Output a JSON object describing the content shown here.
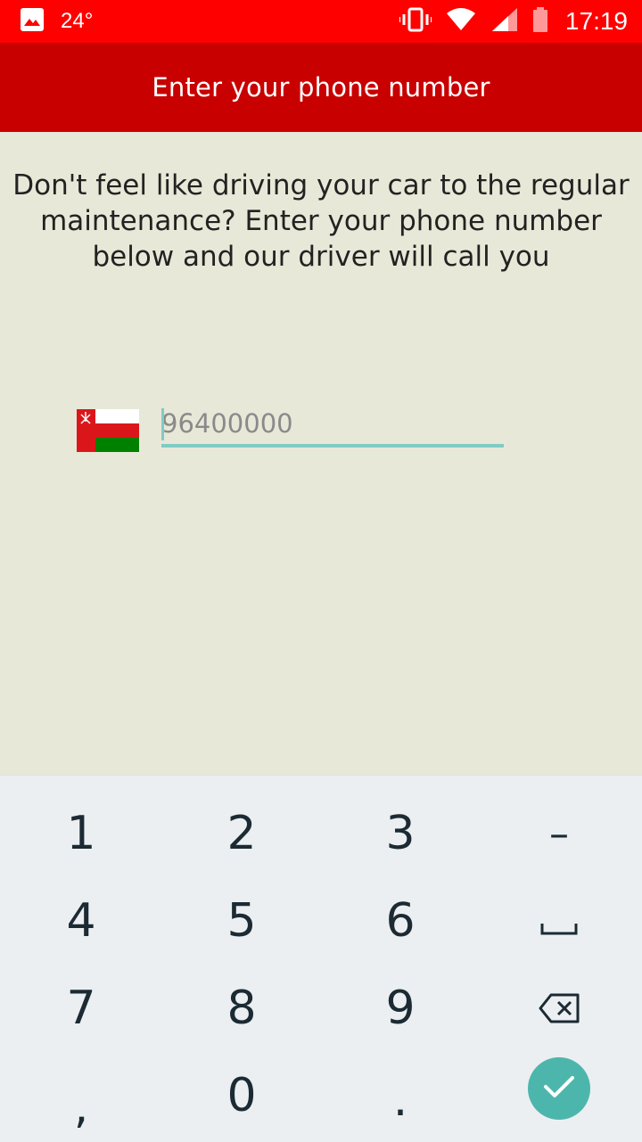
{
  "status_bar": {
    "temperature": "24°",
    "time": "17:19",
    "icons": [
      "gallery-icon",
      "vibrate-icon",
      "wifi-icon",
      "signal-icon",
      "battery-icon"
    ]
  },
  "app_bar": {
    "title": "Enter your phone number"
  },
  "main": {
    "intro_text": "Don't feel like driving your car to the regular maintenance? Enter your phone number below and our driver will call you",
    "country_flag": "oman-flag",
    "phone_input": {
      "placeholder": "96400000",
      "value": ""
    }
  },
  "keyboard": {
    "keys": {
      "k1": "1",
      "k2": "2",
      "k3": "3",
      "dash": "–",
      "k4": "4",
      "k5": "5",
      "k6": "6",
      "k7": "7",
      "k8": "8",
      "k9": "9",
      "comma": ",",
      "k0": "0",
      "period": "."
    },
    "icons": [
      "space-icon",
      "backspace-icon",
      "done-check-icon"
    ]
  },
  "colors": {
    "status_bar": "#ff0000",
    "app_bar": "#c80000",
    "background": "#e8e8d8",
    "accent": "#80cbc4",
    "done_button": "#4db6ac"
  }
}
